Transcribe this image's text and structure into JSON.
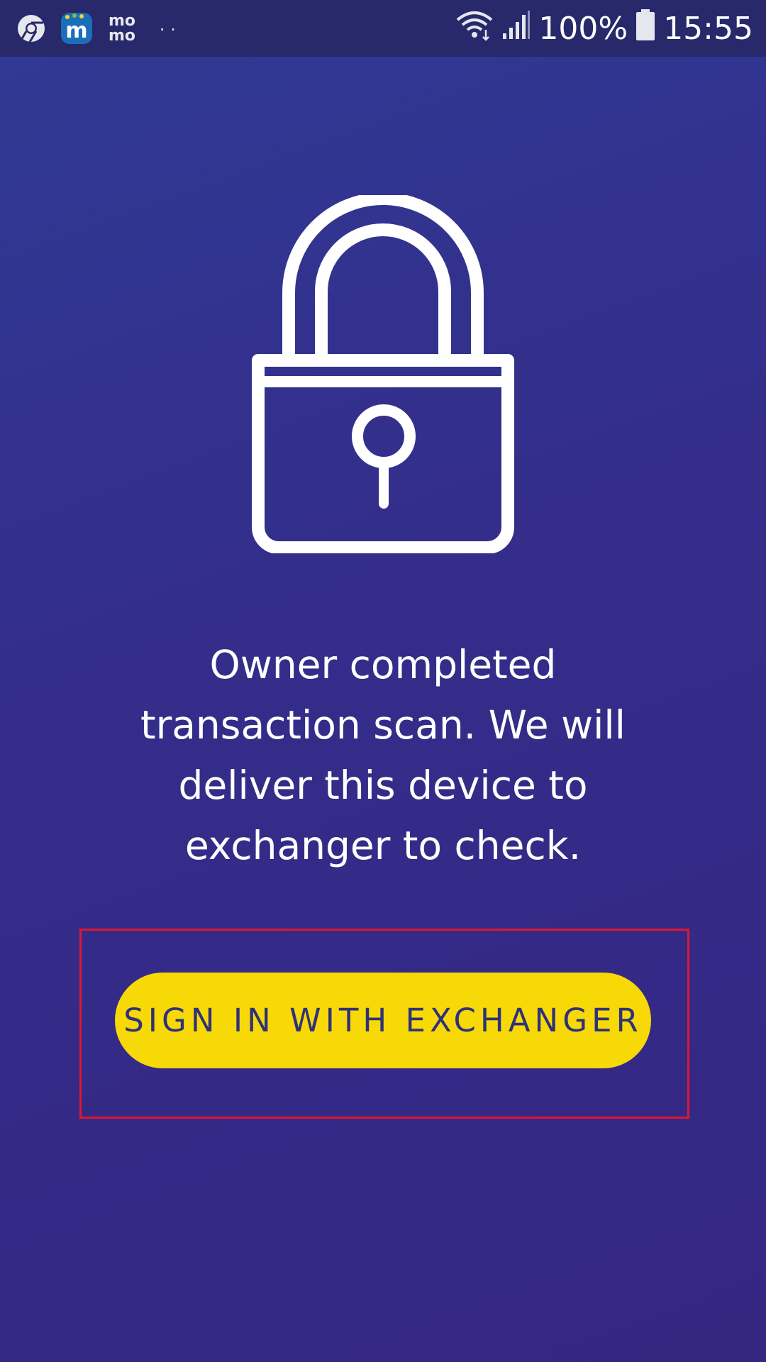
{
  "status_bar": {
    "left_icons": [
      "chrome-icon",
      "app-m-icon",
      "momo-icon",
      "more-notifications-icon"
    ],
    "momo_line_1": "mo",
    "momo_line_2": "mo",
    "overflow_dots": "··",
    "right_icons": [
      "wifi-icon",
      "signal-icon",
      "battery-icon"
    ],
    "battery": "100%",
    "time": "15:55"
  },
  "main": {
    "illustration": "padlock-icon",
    "message": "Owner completed transaction scan. We will deliver this device to exchanger to check.",
    "button_label": "SIGN IN WITH EXCHANGER"
  },
  "colors": {
    "background_top": "#2f3a94",
    "background_bottom": "#352682",
    "status_bar": "#27296b",
    "button": "#f8d908",
    "button_text": "#2f3278",
    "highlight_border": "#e0152e"
  }
}
